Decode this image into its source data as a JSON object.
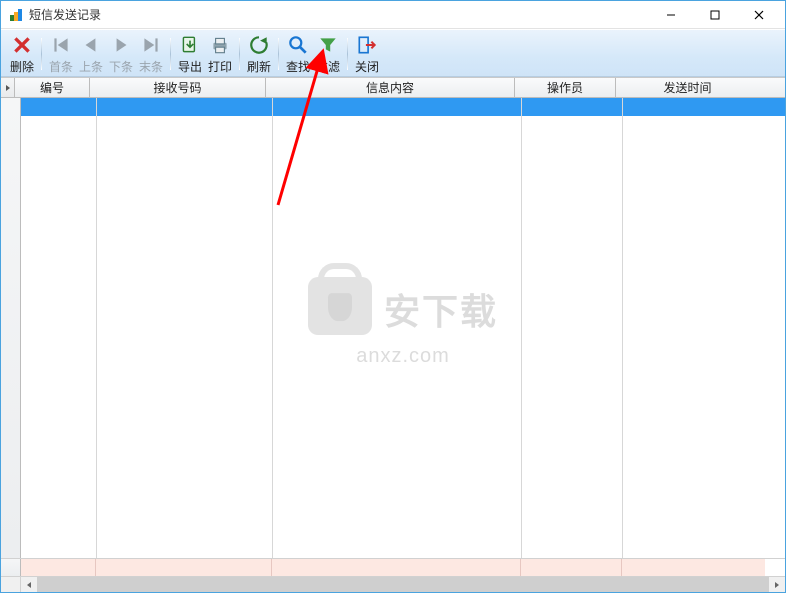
{
  "window": {
    "title": "短信发送记录"
  },
  "toolbar": {
    "delete": "删除",
    "first": "首条",
    "prev": "上条",
    "next": "下条",
    "last": "末条",
    "export": "导出",
    "print": "打印",
    "refresh": "刷新",
    "find": "查找",
    "filter": "过滤",
    "close": "关闭"
  },
  "columns": {
    "c0": "编号",
    "c1": "接收号码",
    "c2": "信息内容",
    "c3": "操作员",
    "c4": "发送时间"
  },
  "watermark": {
    "text": "安下载",
    "domain": "anxz.com"
  },
  "col_widths": {
    "c0": 75,
    "c1": 176,
    "c2": 249,
    "c3": 101,
    "c4": 143
  }
}
